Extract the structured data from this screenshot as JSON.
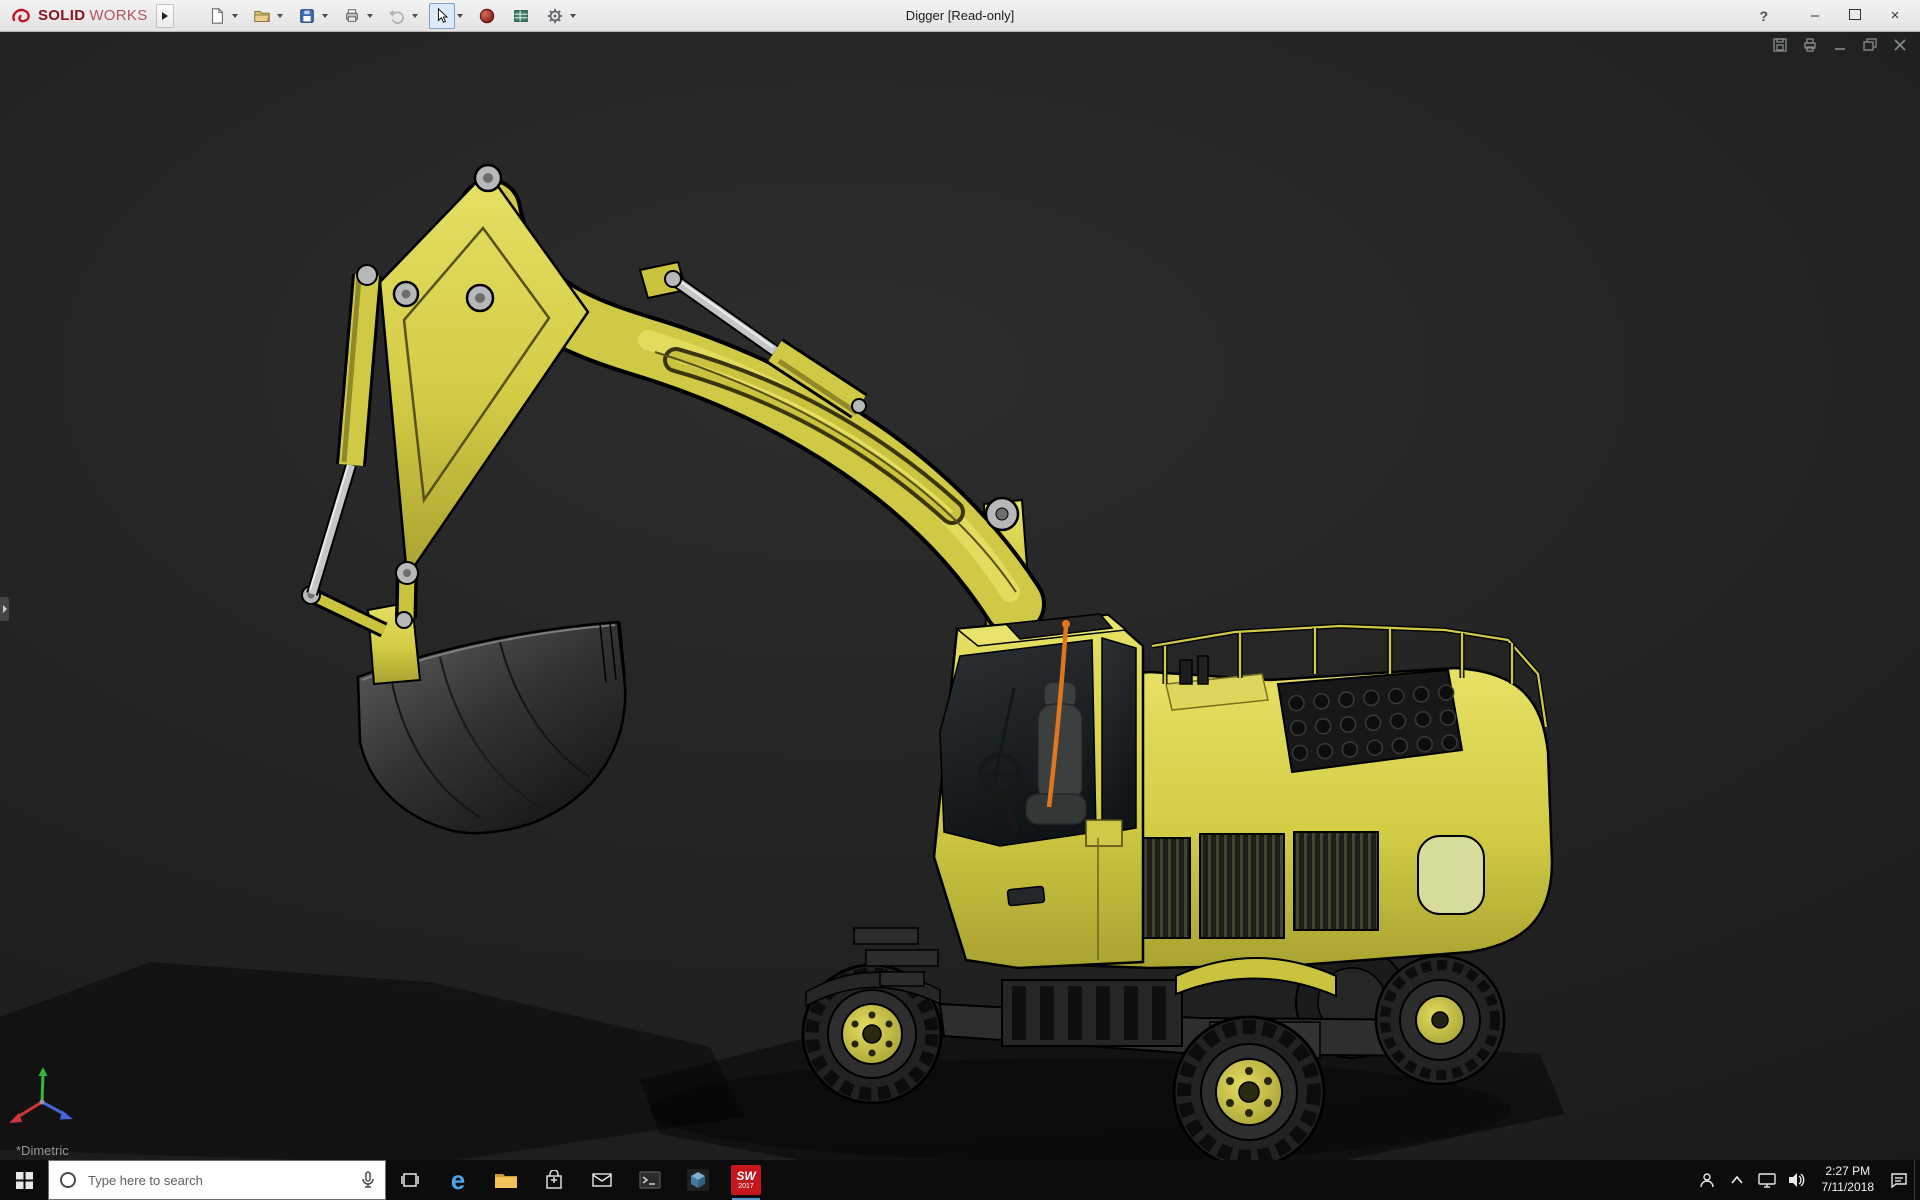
{
  "colors": {
    "brand_red": "#a11622",
    "titlebar_bg": "#e9e7e8",
    "viewport_bg": "#222222",
    "taskbar_bg": "#0c0c0c",
    "model_yellow": "#d2cc45",
    "cable_orange": "#e0761e"
  },
  "titlebar": {
    "brand_bold": "SOLID",
    "brand_light": "WORKS",
    "document_title": "Digger [Read-only]",
    "help_label": "?",
    "minimize_label": "–",
    "close_label": "×",
    "toolbar_icons": [
      "new-document",
      "open",
      "save",
      "print",
      "undo",
      "select",
      "appearance-sphere",
      "design-table",
      "options-gear"
    ]
  },
  "viewport": {
    "orientation_label": "*Dimetric",
    "document_window_icons": [
      "save",
      "print",
      "minimize",
      "restore",
      "close"
    ]
  },
  "taskbar": {
    "search_placeholder": "Type here to search",
    "edge_letter": "e",
    "solidworks_label": "SW",
    "solidworks_year": "2017",
    "time": "2:27 PM",
    "date": "7/11/2018",
    "app_icons": [
      "start",
      "task-view",
      "edge",
      "file-explorer",
      "store",
      "mail",
      "console",
      "model-viewer",
      "solidworks-2017"
    ],
    "tray_icons": [
      "people",
      "hidden-icons",
      "network",
      "volume",
      "action-center"
    ]
  }
}
